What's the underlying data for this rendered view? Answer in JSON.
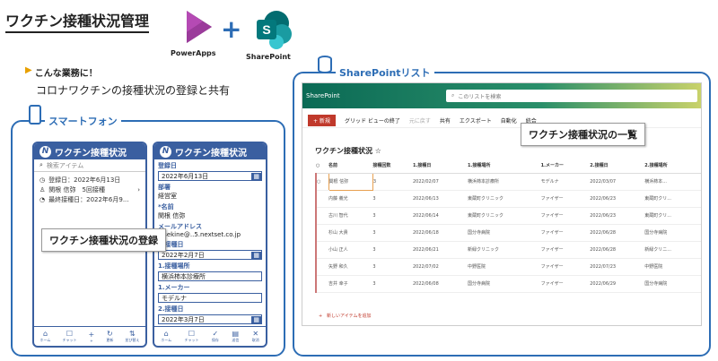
{
  "title": "ワクチン接種状況管理",
  "apps": {
    "powerapps": "PowerApps",
    "sharepoint": "SharePoint",
    "plus": "+"
  },
  "intro": {
    "bullet": "こんな業務に！",
    "text": "コロナワクチンの接種状況の登録と共有"
  },
  "smartphone_label": "スマートフォン",
  "sharepoint_list_label": "SharePointリスト",
  "phone1": {
    "app_title": "ワクチン接種状況",
    "search_placeholder": "検索アイテム",
    "reg_date": "登録日：2022年6月13日",
    "person": "関根 信弥　5回接種",
    "last": "最終接種日：2022年6月9...",
    "nav": [
      "ホーム",
      "チャット",
      "+",
      "更新",
      "並び替え"
    ]
  },
  "phone2": {
    "app_title": "ワクチン接種状況",
    "fields": [
      {
        "label": "登録日",
        "value": "2022年6月13日",
        "box": true
      },
      {
        "label": "部署",
        "value": "経営室",
        "box": false
      },
      {
        "label": "*名前",
        "value": "関根 信弥",
        "box": false
      },
      {
        "label": "メールアドレス",
        "value": "s-sekine@..5.nextset.co.jp",
        "box": false
      },
      {
        "label": "1.接種日",
        "value": "2022年2月7日",
        "box": true
      },
      {
        "label": "1.接種場所",
        "value": "横浜柿本診療所",
        "box": true
      },
      {
        "label": "1.メーカー",
        "value": "モデルナ",
        "box": true
      },
      {
        "label": "2.接種日",
        "value": "2022年3月7日",
        "box": true
      }
    ],
    "nav": [
      "ホーム",
      "チャット",
      "保存",
      "送信",
      "取消"
    ]
  },
  "callout_register": "ワクチン接種状況の登録",
  "callout_list": "ワクチン接種状況の一覧",
  "sp": {
    "header": "SharePoint",
    "search": "このリストを検索",
    "cmds": [
      "+ 新規",
      "グリッド ビューの終了",
      "元に戻す",
      "共有",
      "エクスポート",
      "自動化",
      "統合"
    ],
    "list_title": "ワクチン接種状況 ☆",
    "columns": [
      "名前",
      "接種回数",
      "1.接種日",
      "1.接種場所",
      "1.メーカー",
      "2.接種日",
      "2.接種場所"
    ],
    "rows": [
      [
        "関根 信弥",
        "3",
        "2022/02/07",
        "横浜柿本診療所",
        "モデルナ",
        "2022/03/07",
        "横浜柿本..."
      ],
      [
        "内藤 義光",
        "3",
        "2022/06/13",
        "東蔵町クリニック",
        "ファイザー",
        "2022/06/23",
        "東蔵町クリ..."
      ],
      [
        "古川 智代",
        "3",
        "2022/06/14",
        "東蔵町クリニック",
        "ファイザー",
        "2022/06/23",
        "東蔵町クリ..."
      ],
      [
        "杉山 大貴",
        "3",
        "2022/06/18",
        "国分寺病院",
        "ファイザー",
        "2022/06/28",
        "国分寺病院"
      ],
      [
        "小山 正人",
        "3",
        "2022/06/21",
        "新緑クリニック",
        "ファイザー",
        "2022/06/28",
        "新緑クリニ..."
      ],
      [
        "矢野 和久",
        "3",
        "2022/07/02",
        "中野医院",
        "ファイザー",
        "2022/07/23",
        "中野医院"
      ],
      [
        "吉井 幸子",
        "3",
        "2022/06/08",
        "国分寺病院",
        "ファイザー",
        "2022/06/29",
        "国分寺病院"
      ]
    ],
    "add_new": "新しいアイテムを追加"
  }
}
